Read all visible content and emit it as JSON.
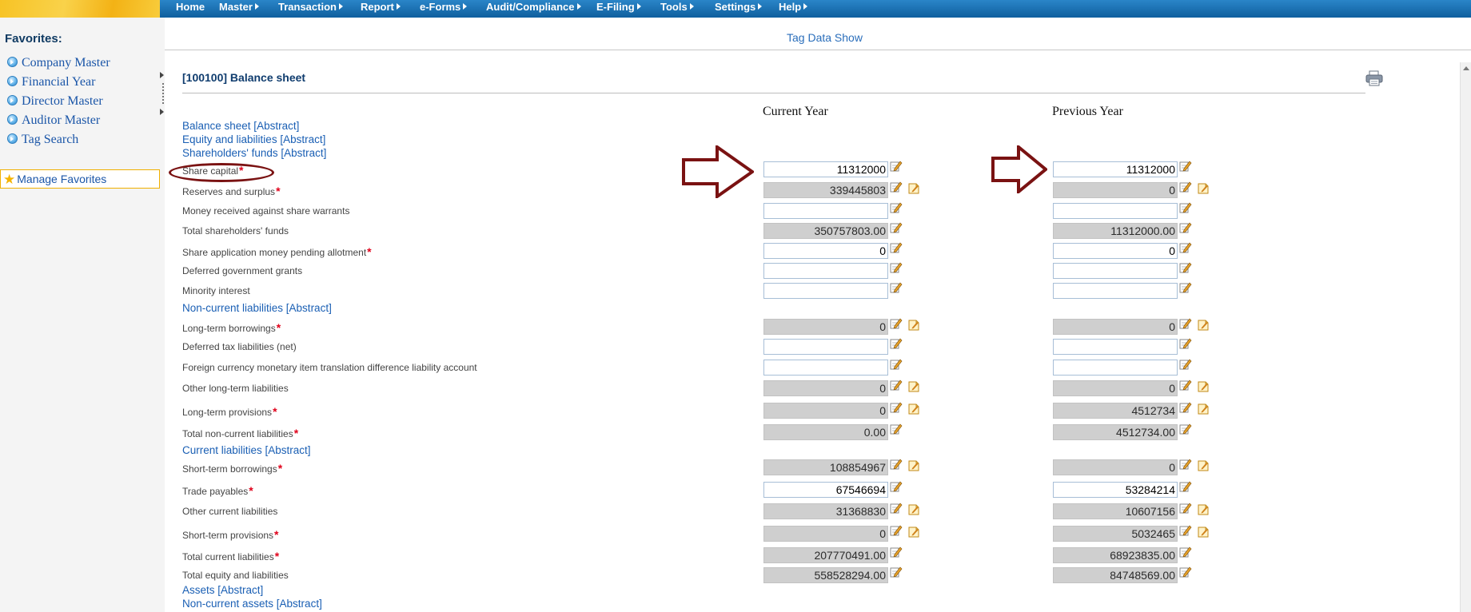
{
  "menu": [
    "Home",
    "Master",
    "Transaction",
    "Report",
    "e-Forms",
    "Audit/Compliance",
    "E-Filing",
    "Tools",
    "Settings",
    "Help"
  ],
  "sidebar": {
    "title": "Favorites:",
    "items": [
      "Company Master",
      "Financial Year",
      "Director Master",
      "Auditor Master",
      "Tag Search"
    ],
    "manage": "Manage Favorites"
  },
  "header": {
    "tag_data_show": "Tag Data Show",
    "section_title": "[100100] Balance sheet"
  },
  "columns": {
    "current": "Current Year",
    "previous": "Previous Year"
  },
  "rows": [
    {
      "kind": "abstract",
      "label": "Balance sheet [Abstract]"
    },
    {
      "kind": "abstract",
      "label": "Equity and liabilities [Abstract]"
    },
    {
      "kind": "abstract",
      "label": "Shareholders' funds [Abstract]"
    },
    {
      "kind": "item",
      "label": "Share capital",
      "required": true,
      "cur": "11312000",
      "cur_ro": false,
      "prev": "11312000",
      "prev_ro": false,
      "note": false
    },
    {
      "kind": "item",
      "label": "Reserves and surplus",
      "required": true,
      "cur": "339445803",
      "cur_ro": true,
      "prev": "0",
      "prev_ro": true,
      "note": true
    },
    {
      "kind": "item",
      "label": "Money received against share warrants",
      "required": false,
      "cur": "",
      "cur_ro": false,
      "prev": "",
      "prev_ro": false,
      "note": false
    },
    {
      "kind": "item",
      "label": "Total shareholders' funds",
      "required": false,
      "cur": "350757803.00",
      "cur_ro": true,
      "prev": "11312000.00",
      "prev_ro": true,
      "note": false
    },
    {
      "kind": "item",
      "label": "Share application money pending allotment",
      "required": true,
      "cur": "0",
      "cur_ro": false,
      "prev": "0",
      "prev_ro": false,
      "note": false
    },
    {
      "kind": "item",
      "label": "Deferred government grants",
      "required": false,
      "cur": "",
      "cur_ro": false,
      "prev": "",
      "prev_ro": false,
      "note": false
    },
    {
      "kind": "item",
      "label": "Minority interest",
      "required": false,
      "cur": "",
      "cur_ro": false,
      "prev": "",
      "prev_ro": false,
      "note": false
    },
    {
      "kind": "abstract",
      "label": "Non-current liabilities [Abstract]"
    },
    {
      "kind": "item",
      "label": "Long-term borrowings",
      "required": true,
      "cur": "0",
      "cur_ro": true,
      "prev": "0",
      "prev_ro": true,
      "note": true
    },
    {
      "kind": "item",
      "label": "Deferred tax liabilities (net)",
      "required": false,
      "cur": "",
      "cur_ro": false,
      "prev": "",
      "prev_ro": false,
      "note": false
    },
    {
      "kind": "item",
      "label": "Foreign currency monetary item translation difference liability account",
      "required": false,
      "cur": "",
      "cur_ro": false,
      "prev": "",
      "prev_ro": false,
      "note": false
    },
    {
      "kind": "item",
      "label": "Other long-term liabilities",
      "required": false,
      "cur": "0",
      "cur_ro": true,
      "prev": "0",
      "prev_ro": true,
      "note": true
    },
    {
      "kind": "item",
      "label": "Long-term provisions",
      "required": true,
      "cur": "0",
      "cur_ro": true,
      "prev": "4512734",
      "prev_ro": true,
      "note": true
    },
    {
      "kind": "item",
      "label": "Total non-current liabilities",
      "required": true,
      "cur": "0.00",
      "cur_ro": true,
      "prev": "4512734.00",
      "prev_ro": true,
      "note": false
    },
    {
      "kind": "abstract",
      "label": "Current liabilities [Abstract]"
    },
    {
      "kind": "item",
      "label": "Short-term borrowings",
      "required": true,
      "cur": "108854967",
      "cur_ro": true,
      "prev": "0",
      "prev_ro": true,
      "note": true
    },
    {
      "kind": "item",
      "label": "Trade payables",
      "required": true,
      "cur": "67546694",
      "cur_ro": false,
      "prev": "53284214",
      "prev_ro": false,
      "note": false
    },
    {
      "kind": "item",
      "label": "Other current liabilities",
      "required": false,
      "cur": "31368830",
      "cur_ro": true,
      "prev": "10607156",
      "prev_ro": true,
      "note": true
    },
    {
      "kind": "item",
      "label": "Short-term provisions",
      "required": true,
      "cur": "0",
      "cur_ro": true,
      "prev": "5032465",
      "prev_ro": true,
      "note": true
    },
    {
      "kind": "item",
      "label": "Total current liabilities",
      "required": true,
      "cur": "207770491.00",
      "cur_ro": true,
      "prev": "68923835.00",
      "prev_ro": true,
      "note": false
    },
    {
      "kind": "item",
      "label": "Total equity and liabilities",
      "required": false,
      "cur": "558528294.00",
      "cur_ro": true,
      "prev": "84748569.00",
      "prev_ro": true,
      "note": false
    },
    {
      "kind": "abstract",
      "label": "Assets [Abstract]"
    },
    {
      "kind": "abstract",
      "label": "Non-current assets [Abstract]"
    }
  ],
  "colors": {
    "menu_bar": "#0f5f9e",
    "link": "#1a5fb4",
    "required": "#e0001a",
    "annotation": "#7a1212",
    "readonly_field": "#cfcfcf"
  }
}
